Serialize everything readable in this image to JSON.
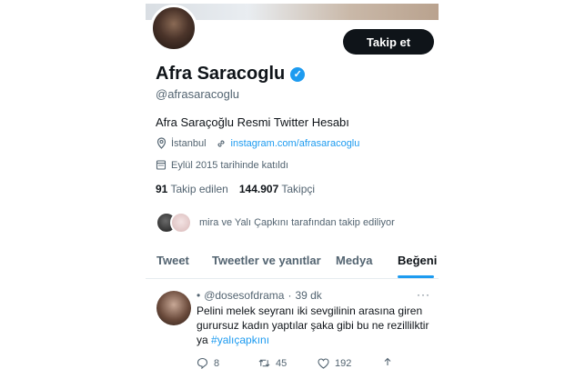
{
  "profile": {
    "follow_label": "Takip et",
    "name": "Afra Saracoglu",
    "verified_icon": "verified-badge-icon",
    "handle": "@afrasaracoglu",
    "bio": "Afra Saraçoğlu Resmi Twitter Hesabı",
    "location": "İstanbul",
    "website": "instagram.com/afrasaracoglu",
    "joined": "Eylül 2015 tarihinde katıldı",
    "following_count": "91",
    "following_label": "Takip edilen",
    "followers_count": "144.907",
    "followers_label": "Takipçi",
    "followed_by": "mira ve Yalı Çapkını tarafından takip ediliyor"
  },
  "tabs": [
    {
      "label": "Tweet",
      "active": false
    },
    {
      "label": "Tweetler ve yanıtlar",
      "active": false
    },
    {
      "label": "Medya",
      "active": false
    },
    {
      "label": "Beğeni",
      "active": true
    }
  ],
  "tweet": {
    "handle": "@dosesofdrama",
    "time": "39 dk",
    "text": "Pelini melek seyranı iki sevgilinin arasına giren gurursuz kadın yaptılar şaka gibi bu ne rezillikir ya",
    "text_exact": "Pelini melek seyranı iki sevgilinin arasına giren gurursuz kadın yaptılar şaka gibi bu ne rezillilktir ya",
    "hashtag": "#yalıçapkını",
    "replies": "8",
    "retweets": "45",
    "likes": "192"
  },
  "colors": {
    "accent": "#1d9bf0",
    "text": "#0f1419",
    "muted": "#536471"
  }
}
